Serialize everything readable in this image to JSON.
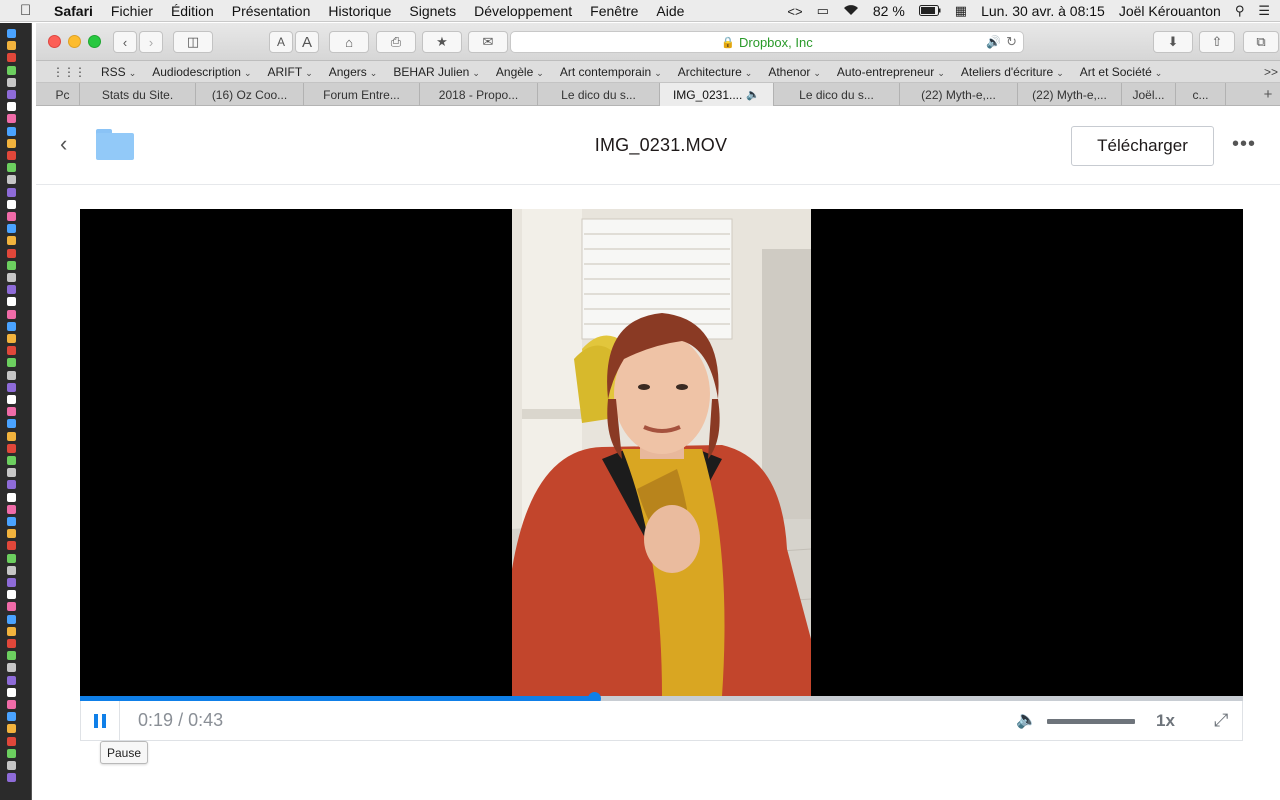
{
  "menubar": {
    "apple_icon": "apple-logo-icon",
    "app": "Safari",
    "items": [
      "Fichier",
      "Édition",
      "Présentation",
      "Historique",
      "Signets",
      "Développement",
      "Fenêtre",
      "Aide"
    ],
    "battery": "82 %",
    "datetime": "Lun. 30 avr. à 08:15",
    "user": "Joël Kérouanton"
  },
  "browser": {
    "url_host": "Dropbox, Inc",
    "font_small": "A",
    "font_large": "A",
    "bookmarks": [
      "RSS",
      "Audiodescription",
      "ARIFT",
      "Angers",
      "BEHAR Julien",
      "Angèle",
      "Art contemporain",
      "Architecture",
      "Athenor",
      "Auto-entrepreneur",
      "Ateliers d'écriture",
      "Art et Société"
    ],
    "bookmarks_more": ">>",
    "tabs": [
      {
        "label": "Pc",
        "width": 34
      },
      {
        "label": "Stats du Site.",
        "width": 116
      },
      {
        "label": "(16) Oz Coo...",
        "width": 108
      },
      {
        "label": "Forum Entre...",
        "width": 116
      },
      {
        "label": "2018 - Propo...",
        "width": 118
      },
      {
        "label": "Le dico du s...",
        "width": 122
      },
      {
        "label": "IMG_0231....",
        "width": 114,
        "active": true,
        "sound": "speaker-icon"
      },
      {
        "label": "Le dico du s...",
        "width": 126
      },
      {
        "label": "(22) Myth-e,...",
        "width": 118
      },
      {
        "label": "(22) Myth-e,...",
        "width": 104
      },
      {
        "label": "Joël...",
        "width": 54
      },
      {
        "label": "c...",
        "width": 50
      }
    ]
  },
  "dropbox": {
    "file_name": "IMG_0231.MOV",
    "download_label": "Télécharger",
    "more_label": "•••",
    "player": {
      "current_time": "0:19",
      "duration": "0:43",
      "time_separator": "/",
      "progress_fraction": 0.442,
      "speed": "1x",
      "tooltip": "Pause"
    }
  },
  "colors": {
    "accent": "#0f7fe8",
    "folder": "#92c9f8",
    "secure": "#2a9a2a"
  }
}
